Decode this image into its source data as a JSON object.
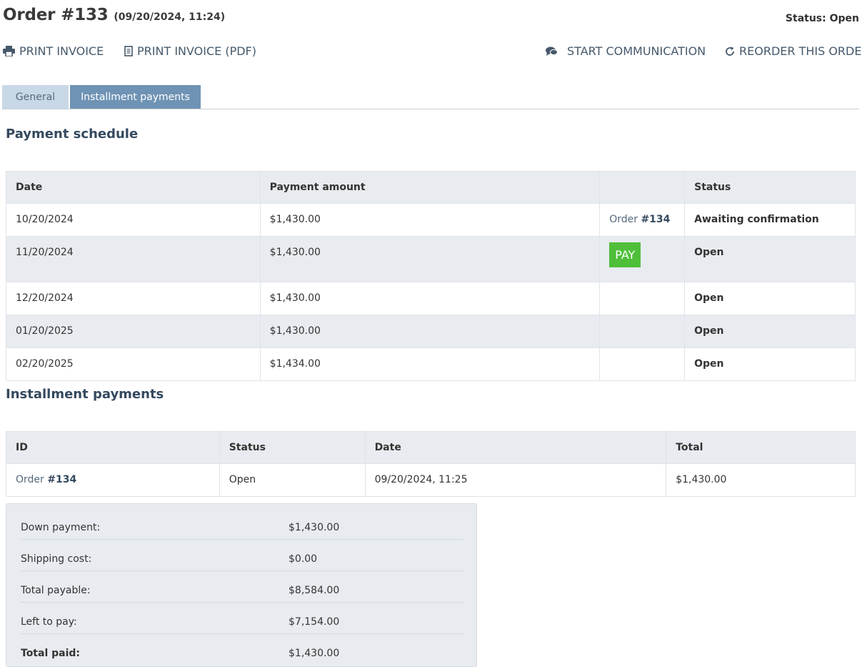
{
  "header": {
    "order_title": "Order #133",
    "order_date": "(09/20/2024, 11:24)",
    "status": "Status: Open"
  },
  "actions": {
    "print_invoice": "PRINT INVOICE",
    "print_invoice_pdf": "PRINT INVOICE (PDF)",
    "start_communication": "START COMMUNICATION",
    "reorder": "REORDER THIS ORDER",
    "icons": [
      "printer-icon",
      "document-icon",
      "chat-icon",
      "refresh-icon"
    ]
  },
  "tabs": [
    {
      "label": "General",
      "active": false
    },
    {
      "label": "Installment payments",
      "active": true
    }
  ],
  "schedule": {
    "title": "Payment schedule",
    "headers": [
      "Date",
      "Payment amount",
      "",
      "Status"
    ],
    "rows": [
      {
        "date": "10/20/2024",
        "amount": "$1,430.00",
        "action_prefix": "Order ",
        "action_id": "#134",
        "status": "Awaiting confirmation"
      },
      {
        "date": "11/20/2024",
        "amount": "$1,430.00",
        "pay_label": "PAY",
        "status": "Open"
      },
      {
        "date": "12/20/2024",
        "amount": "$1,430.00",
        "status": "Open"
      },
      {
        "date": "01/20/2025",
        "amount": "$1,430.00",
        "status": "Open"
      },
      {
        "date": "02/20/2025",
        "amount": "$1,434.00",
        "status": "Open"
      }
    ]
  },
  "installments": {
    "title": "Installment payments",
    "headers": [
      "ID",
      "Status",
      "Date",
      "Total"
    ],
    "rows": [
      {
        "id_prefix": "Order ",
        "id": "#134",
        "status": "Open",
        "date": "09/20/2024, 11:25",
        "total": "$1,430.00"
      }
    ]
  },
  "summary": [
    {
      "label": "Down payment:",
      "value": "$1,430.00"
    },
    {
      "label": "Shipping cost:",
      "value": "$0.00"
    },
    {
      "label": "Total payable:",
      "value": "$8,584.00"
    },
    {
      "label": "Left to pay:",
      "value": "$7,154.00"
    },
    {
      "label": "Total paid:",
      "value": "$1,430.00"
    }
  ],
  "colors": {
    "tab_active": "#6f93b4",
    "tab_inactive": "#c9d8e7",
    "pay_button": "#4fbf3a",
    "header_bg": "#e8ebef",
    "text_link": "#46596b"
  }
}
